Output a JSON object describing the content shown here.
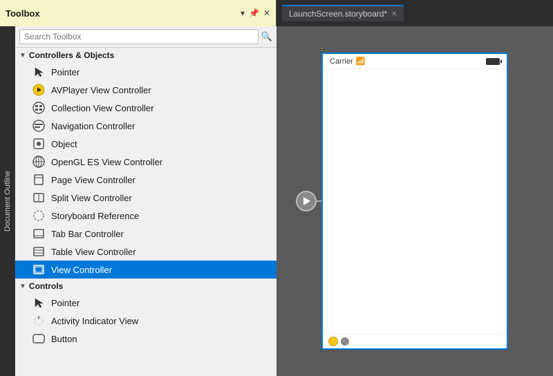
{
  "topbar": {
    "toolbox_title": "Toolbox",
    "tab_label": "LaunchScreen.storyboard*",
    "pin_icon": "📌",
    "dropdown_icon": "▾",
    "close_icon": "✕"
  },
  "search": {
    "placeholder": "Search Toolbox"
  },
  "sidebar": {
    "label": "Document Outline"
  },
  "controllers_section": {
    "label": "Controllers & Objects",
    "items": [
      {
        "name": "Pointer",
        "icon": "cursor"
      },
      {
        "name": "AVPlayer View Controller",
        "icon": "avplayer"
      },
      {
        "name": "Collection View Controller",
        "icon": "collection"
      },
      {
        "name": "Navigation Controller",
        "icon": "navigation"
      },
      {
        "name": "Object",
        "icon": "object"
      },
      {
        "name": "OpenGL ES View Controller",
        "icon": "opengl"
      },
      {
        "name": "Page View Controller",
        "icon": "pageview"
      },
      {
        "name": "Split View Controller",
        "icon": "split"
      },
      {
        "name": "Storyboard Reference",
        "icon": "storyboard"
      },
      {
        "name": "Tab Bar Controller",
        "icon": "tabbar"
      },
      {
        "name": "Table View Controller",
        "icon": "tableview"
      },
      {
        "name": "View Controller",
        "icon": "viewcontroller",
        "selected": true
      }
    ]
  },
  "controls_section": {
    "label": "Controls",
    "items": [
      {
        "name": "Pointer",
        "icon": "cursor"
      },
      {
        "name": "Activity Indicator View",
        "icon": "activity"
      },
      {
        "name": "Button",
        "icon": "button"
      }
    ]
  },
  "storyboard": {
    "watermark": "LaunchScreen.storyboard",
    "status_carrier": "Carrier",
    "status_wifi": "▾",
    "status_battery": "▊"
  }
}
